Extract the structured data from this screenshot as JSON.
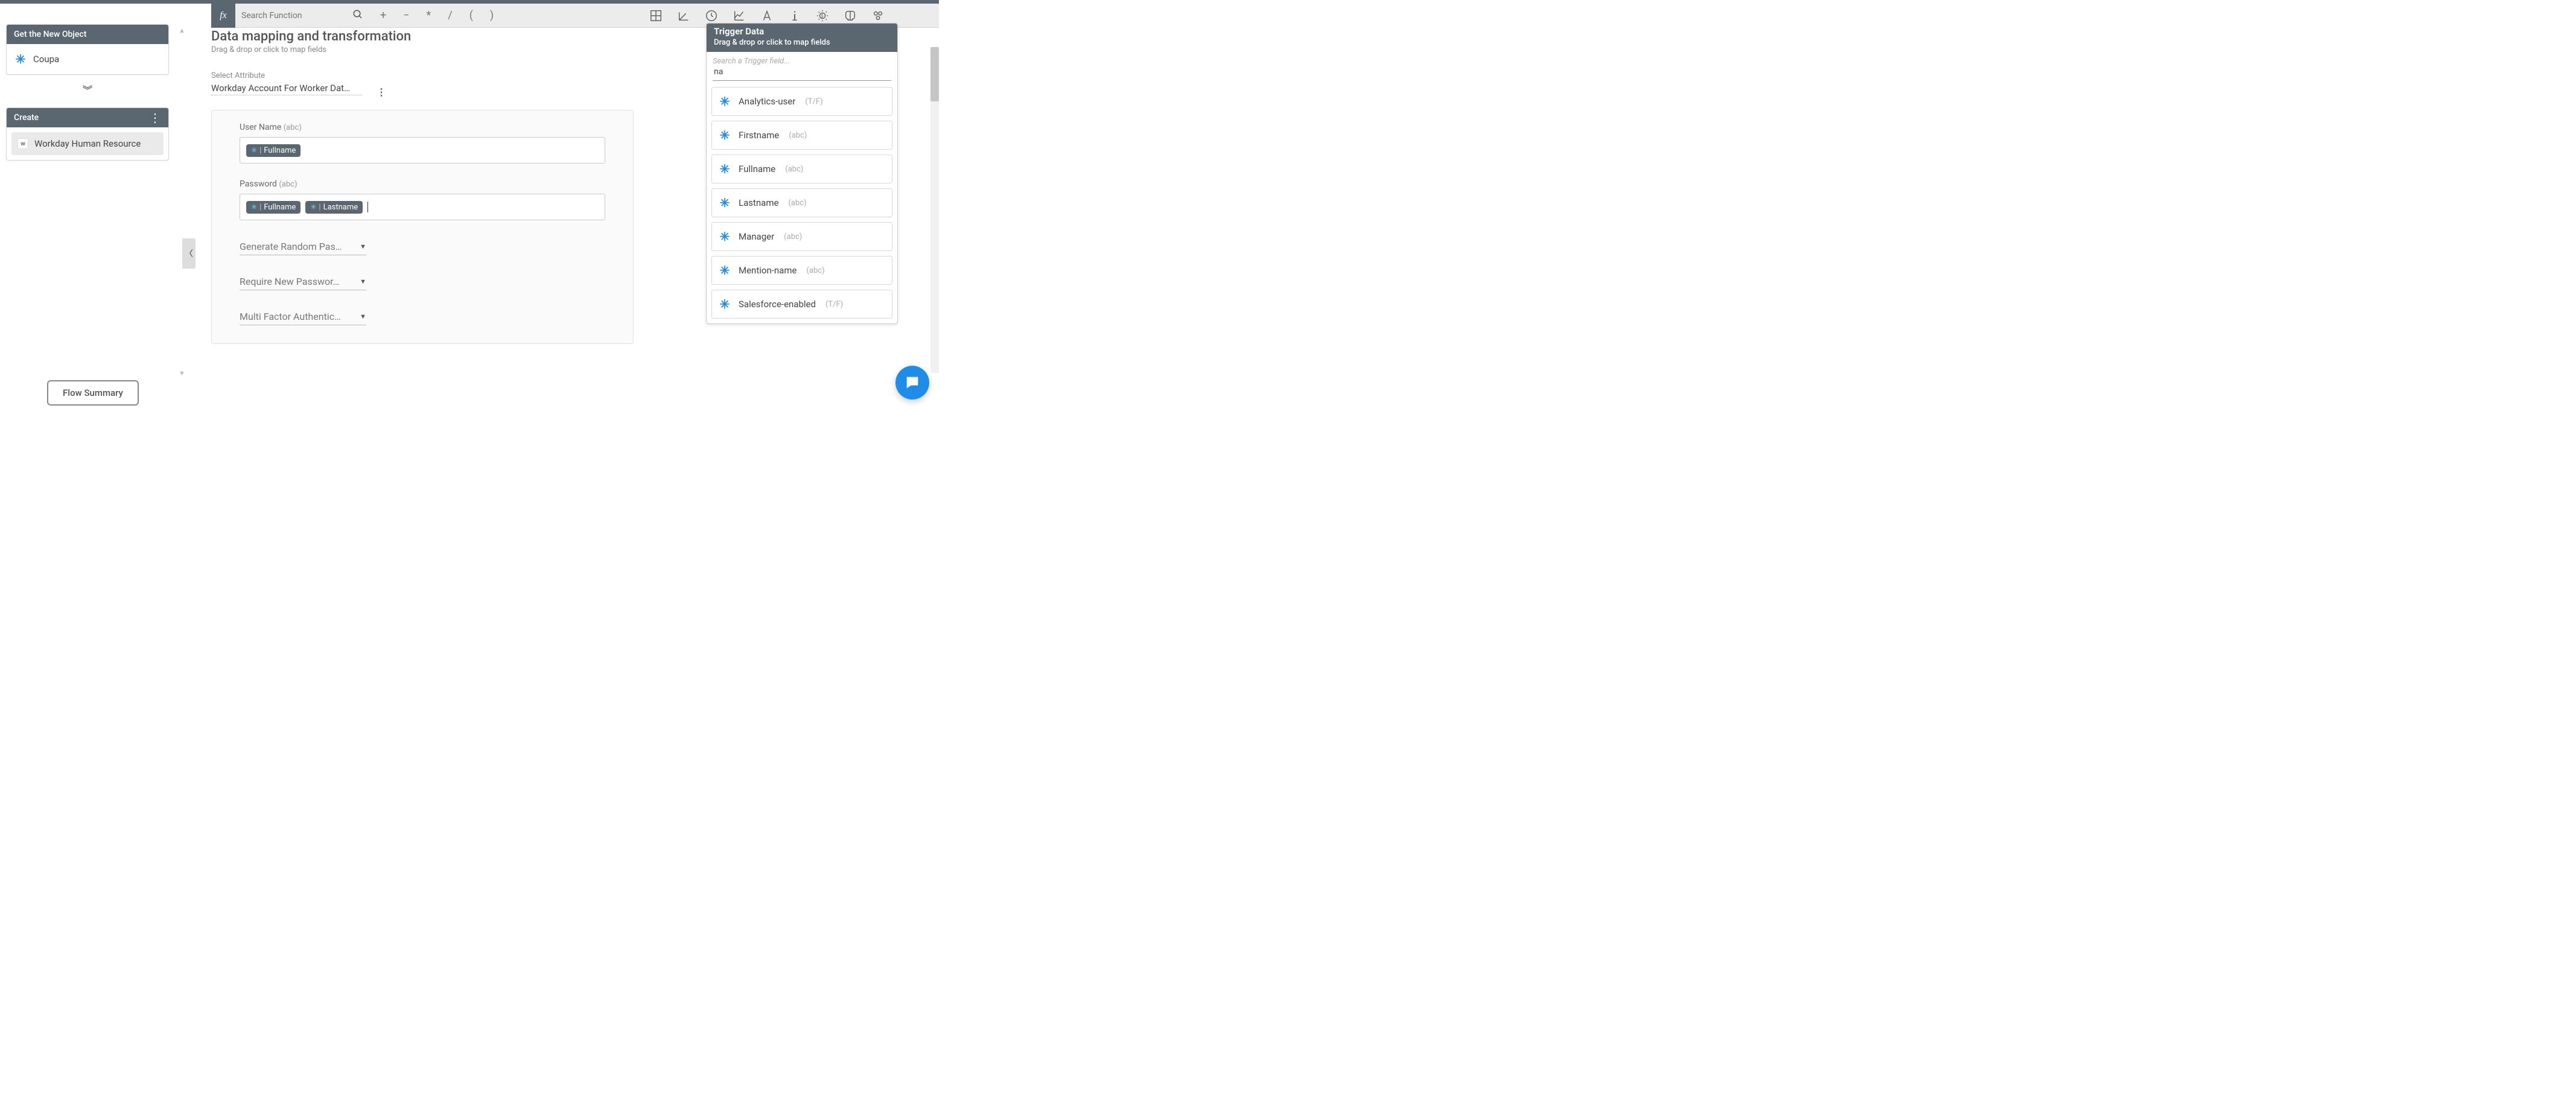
{
  "fx_bar": {
    "search_placeholder": "Search Function",
    "ops": [
      "+",
      "−",
      "*",
      "/",
      "(",
      ")"
    ]
  },
  "left": {
    "get_header": "Get the New Object",
    "get_item": "Coupa",
    "create_header": "Create",
    "create_item": "Workday Human Resource"
  },
  "flow_summary": "Flow Summary",
  "main": {
    "title": "Data mapping and transformation",
    "subtitle": "Drag & drop or click to map fields",
    "select_attr_label": "Select Attribute",
    "select_attr_value": "Workday Account For Worker Dat…",
    "fields": {
      "username_label": "User Name",
      "username_type": "(abc)",
      "username_chips": [
        "Fullname"
      ],
      "password_label": "Password",
      "password_type": "(abc)",
      "password_chips": [
        "Fullname",
        "Lastname"
      ]
    },
    "dropdowns": [
      "Generate Random Pas…",
      "Require New Passwor…",
      "Multi Factor Authentic…"
    ]
  },
  "trigger": {
    "title": "Trigger Data",
    "subtitle": "Drag & drop or click to map fields",
    "search_placeholder": "Search a Trigger field...",
    "search_value": "na",
    "items": [
      {
        "name": "Analytics-user",
        "type": "(T/F)"
      },
      {
        "name": "Firstname",
        "type": "(abc)"
      },
      {
        "name": "Fullname",
        "type": "(abc)"
      },
      {
        "name": "Lastname",
        "type": "(abc)"
      },
      {
        "name": "Manager",
        "type": "(abc)"
      },
      {
        "name": "Mention-name",
        "type": "(abc)"
      },
      {
        "name": "Salesforce-enabled",
        "type": "(T/F)"
      }
    ]
  }
}
